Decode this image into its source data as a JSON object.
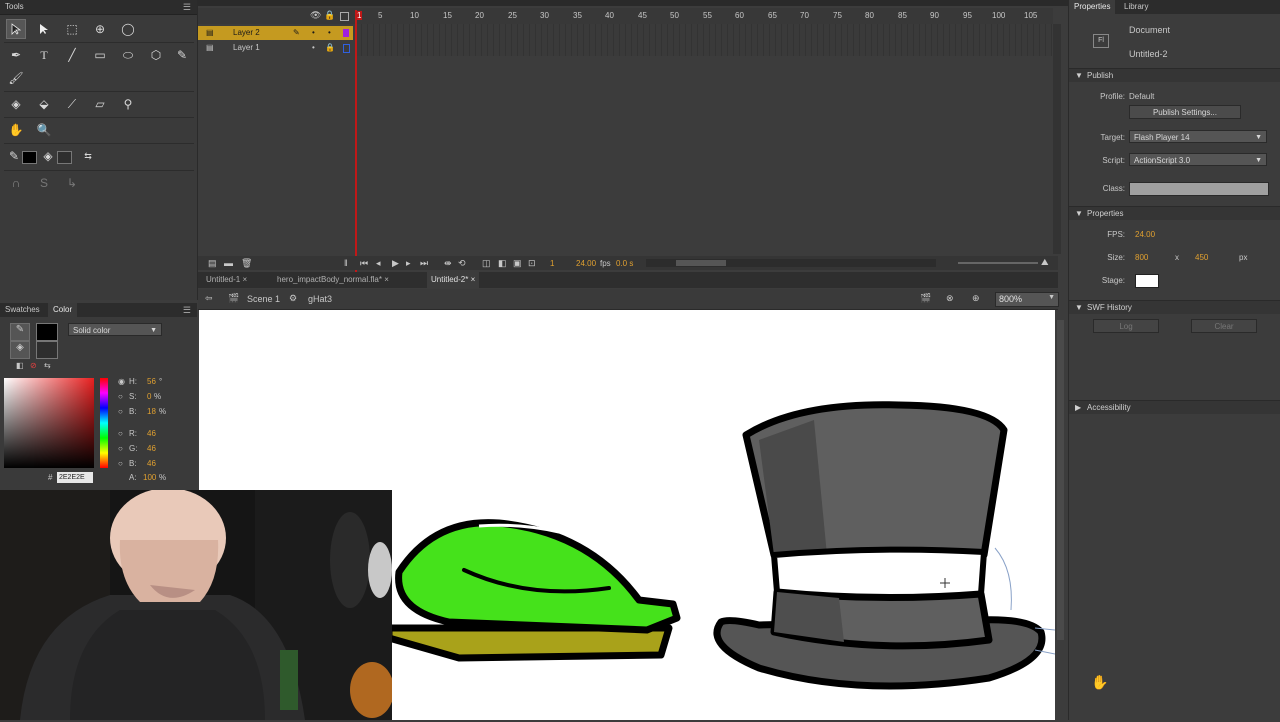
{
  "tools_panel": {
    "title": "Tools"
  },
  "timeline": {
    "layers": [
      {
        "name": "Layer 2",
        "selected": true
      },
      {
        "name": "Layer 1",
        "selected": false
      }
    ],
    "frame_ticks": [
      "1",
      "5",
      "10",
      "15",
      "20",
      "25",
      "30",
      "35",
      "40",
      "45",
      "50",
      "55",
      "60",
      "65",
      "70",
      "75",
      "80",
      "85",
      "90",
      "95",
      "100",
      "105"
    ],
    "current_frame": "1",
    "fps_display": "24.00",
    "fps_unit": "fps",
    "time_display": "0.0 s"
  },
  "doc_tabs": [
    {
      "label": "Untitled-1",
      "active": false
    },
    {
      "label": "hero_impactBody_normal.fla*",
      "active": false
    },
    {
      "label": "Untitled-2*",
      "active": true
    }
  ],
  "edit_bar": {
    "scene": "Scene 1",
    "symbol": "gHat3",
    "zoom": "800%"
  },
  "color_panel": {
    "tabs": [
      "Swatches",
      "Color"
    ],
    "active_tab": "Color",
    "fill_type": "Solid color",
    "hsb": {
      "h_label": "H:",
      "h": "56",
      "h_unit": "°",
      "s_label": "S:",
      "s": "0",
      "s_unit": "%",
      "b_label": "B:",
      "b": "18",
      "b_unit": "%"
    },
    "rgb": {
      "r_label": "R:",
      "r": "46",
      "g_label": "G:",
      "g": "46",
      "b_label": "B:",
      "b": "46"
    },
    "alpha_label": "A:",
    "alpha": "100",
    "alpha_unit": "%",
    "hex_label": "#",
    "hex": "2E2E2E"
  },
  "properties": {
    "tabs": [
      "Properties",
      "Library"
    ],
    "doc_type": "Document",
    "doc_name": "Untitled-2",
    "publish": {
      "section": "Publish",
      "profile_label": "Profile:",
      "profile": "Default",
      "settings_button": "Publish Settings...",
      "target_label": "Target:",
      "target": "Flash Player 14",
      "script_label": "Script:",
      "script": "ActionScript 3.0",
      "class_label": "Class:"
    },
    "props": {
      "section": "Properties",
      "fps_label": "FPS:",
      "fps": "24.00",
      "size_label": "Size:",
      "width": "800",
      "x_label": "x",
      "height": "450",
      "unit": "px",
      "stage_label": "Stage:"
    },
    "swf_history": {
      "section": "SWF History",
      "log_button": "Log",
      "clear_button": "Clear"
    },
    "accessibility": {
      "section": "Accessibility"
    }
  },
  "colors": {
    "stage": "#ffffff",
    "hat_green": "#45e21b",
    "hat_olive": "#a9a21a",
    "tophat_gray": "#5f5f5f",
    "accent": "#e0a030"
  }
}
